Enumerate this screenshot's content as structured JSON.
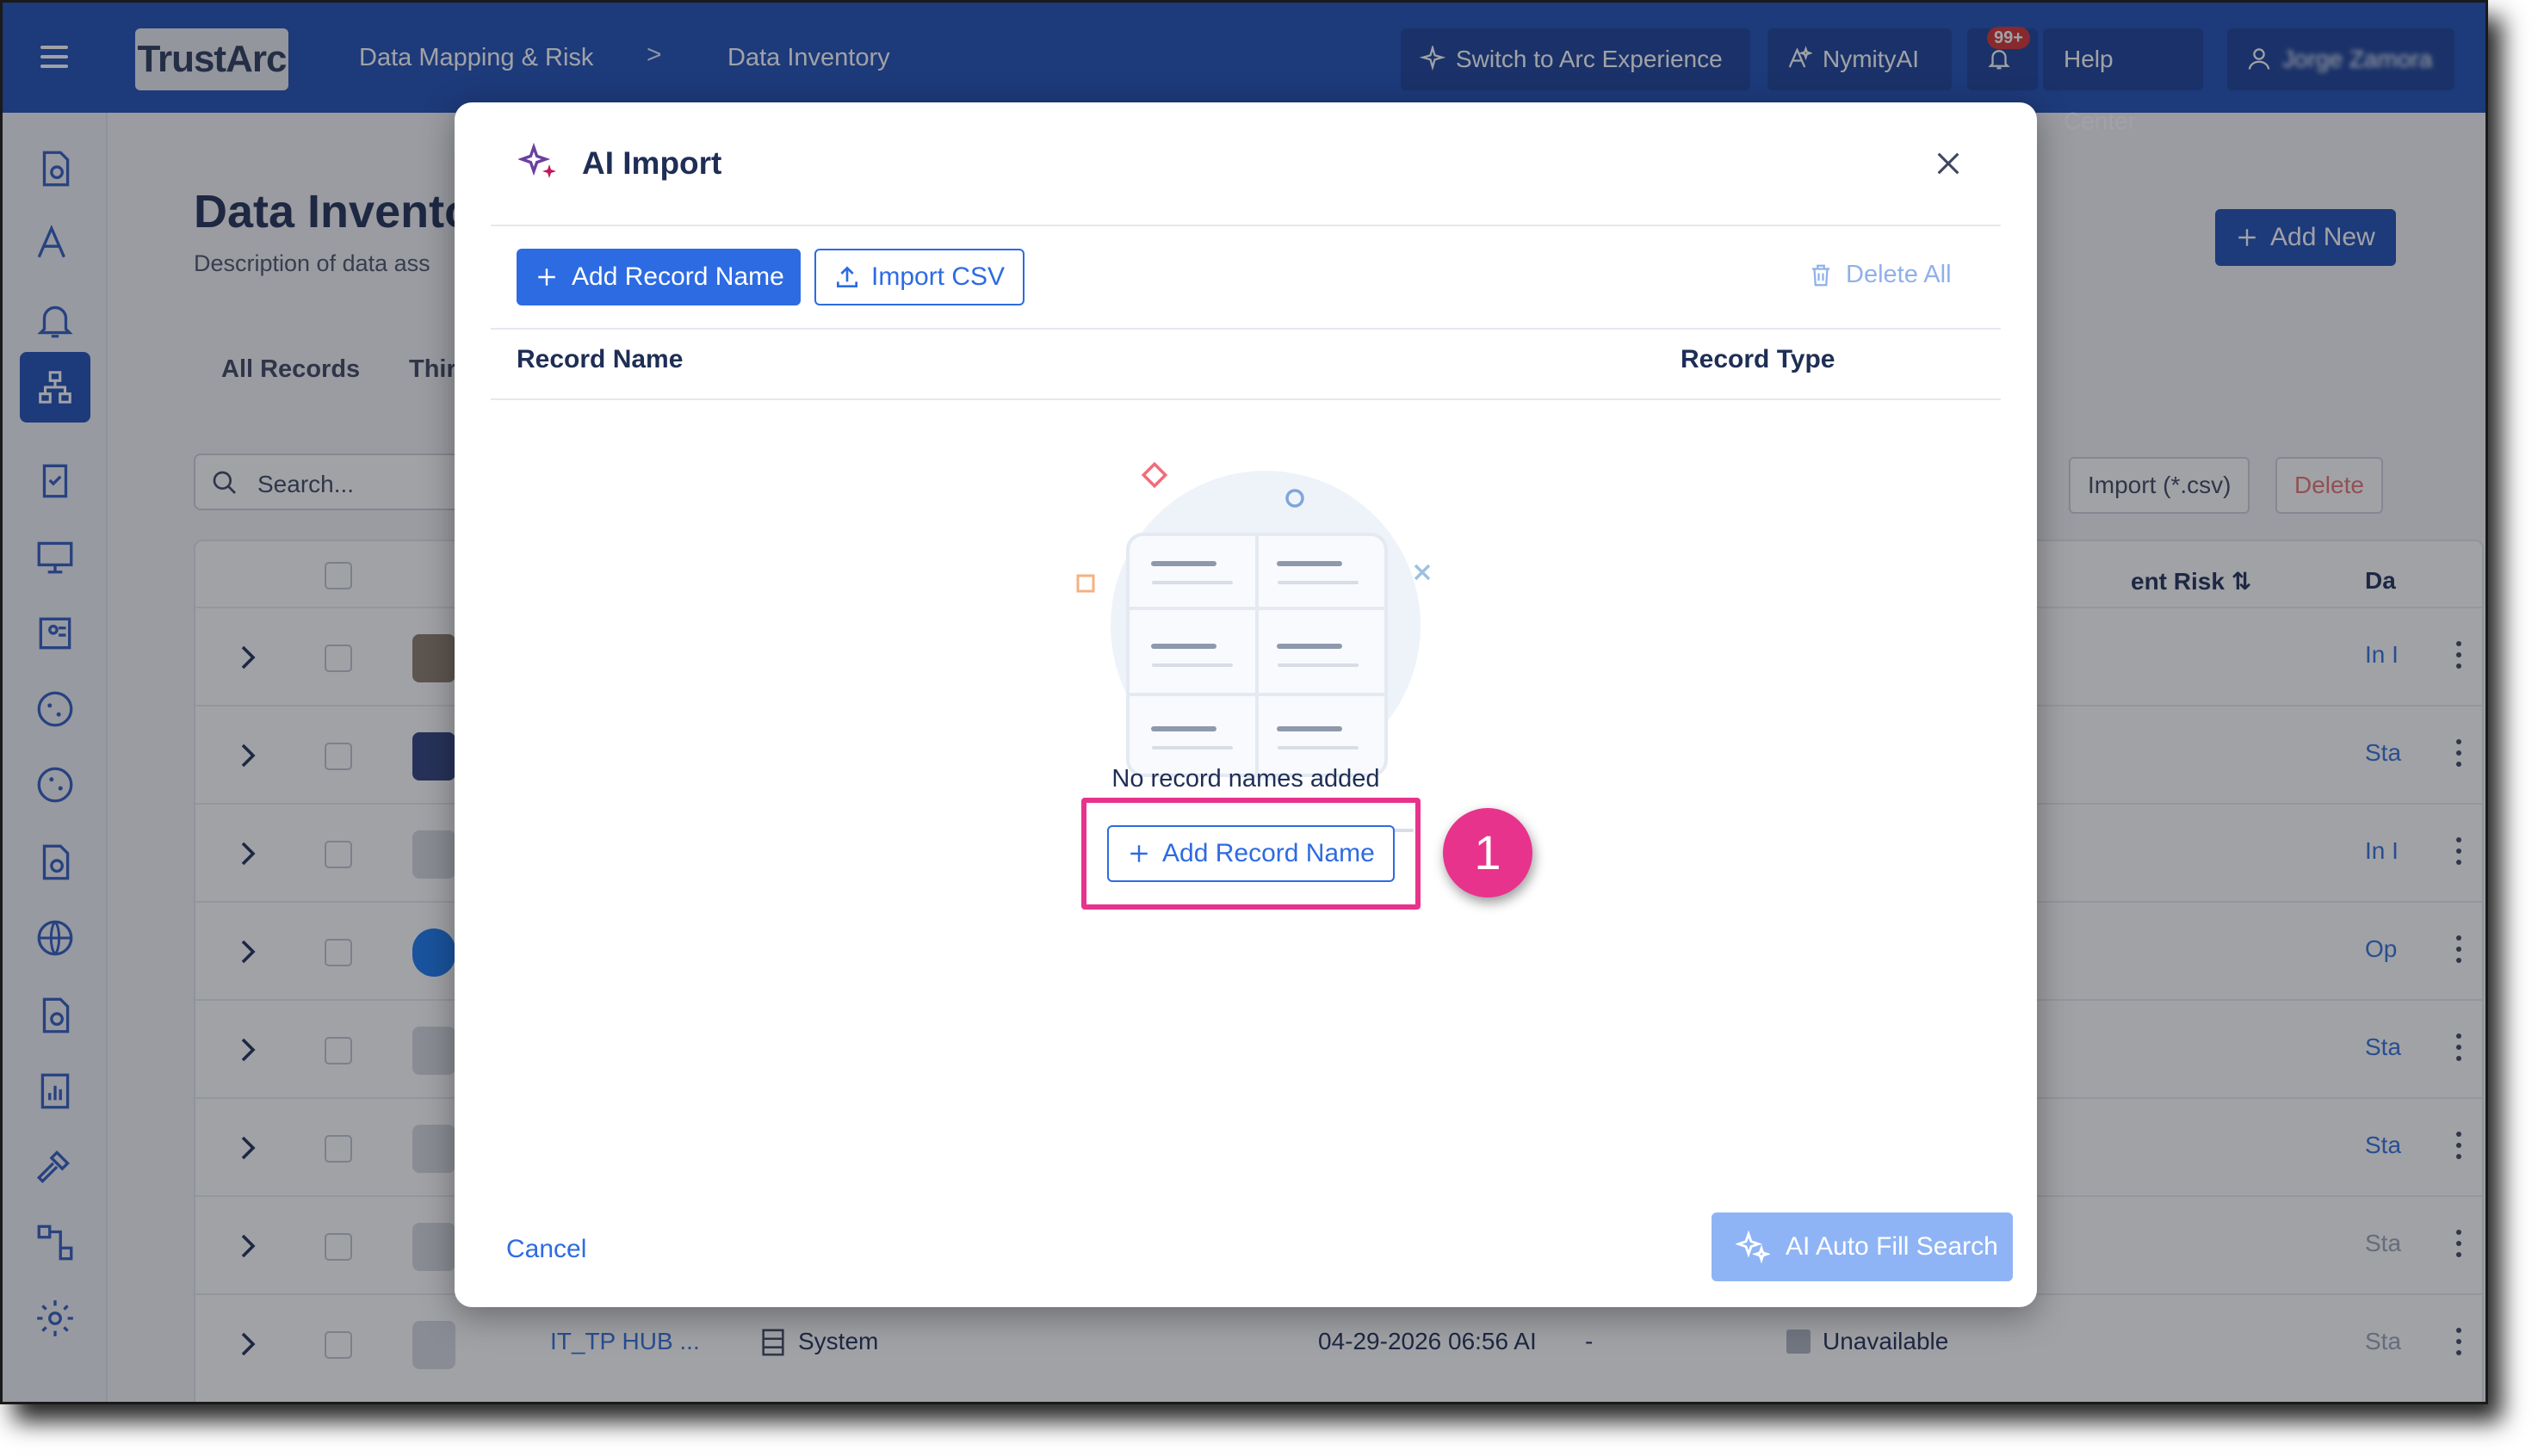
{
  "topbar": {
    "logo": "TrustArc",
    "breadcrumb": [
      "Data Mapping & Risk",
      "Data Inventory"
    ],
    "breadcrumb_sep": ">",
    "switch_label": "Switch to Arc Experience",
    "nymity_label": "NymityAI",
    "notif_badge": "99+",
    "help_label": "Help Center",
    "user_name": "Jorge Zamora"
  },
  "page": {
    "title": "Data Invento",
    "description": "Description of data ass",
    "tabs": [
      "All Records",
      "Thir"
    ],
    "search_placeholder": "Search...",
    "add_new_label": "Add New",
    "import_label": "Import (*.csv)",
    "delete_label": "Delete",
    "col_risk": "ent Risk ⇅",
    "col_da": "Da",
    "rows": [
      {
        "status": "In I"
      },
      {
        "status": "Sta"
      },
      {
        "status": "In I"
      },
      {
        "status": "Op"
      },
      {
        "status": "Sta"
      },
      {
        "status": "Sta"
      },
      {
        "status": "Sta"
      },
      {
        "status": "Sta",
        "name": "IT_TP HUB ...",
        "type": "System",
        "date": "04-29-2026 06:56 AI",
        "dash": "-",
        "avail": "Unavailable"
      }
    ]
  },
  "modal": {
    "title": "AI Import",
    "add_record_label": "Add Record Name",
    "import_csv_label": "Import CSV",
    "delete_all_label": "Delete All",
    "col_record_name": "Record Name",
    "col_record_type": "Record Type",
    "empty_text": "No record names added",
    "empty_add_label": "Add Record Name",
    "step_number": "1",
    "cancel_label": "Cancel",
    "autofill_label": "AI Auto Fill Search"
  },
  "colors": {
    "brand": "#1d4db3",
    "primary": "#2d6be2",
    "highlight": "#e8338c",
    "badge": "#d32f2f"
  },
  "icons": [
    "menu-icon",
    "chevron-right-icon",
    "sparkle-icon",
    "ai-icon",
    "bell-icon",
    "user-icon",
    "search-icon",
    "plus-icon",
    "upload-icon",
    "trash-icon",
    "close-icon",
    "kebab-icon",
    "checkbox-icon",
    "system-icon"
  ]
}
